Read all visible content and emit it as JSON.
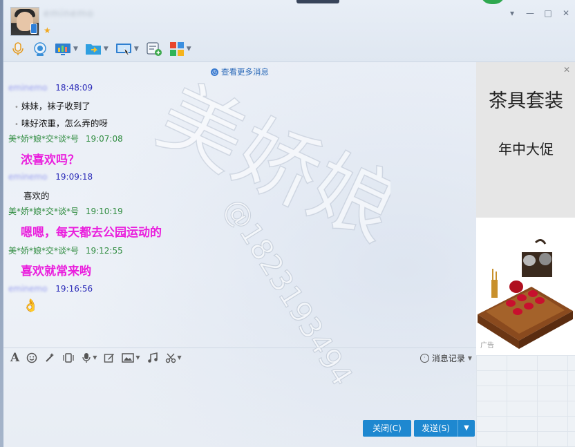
{
  "header": {
    "contact_name": "eminemo",
    "vip_star": "★",
    "window_controls": {
      "menu": "▾",
      "minimize": "—",
      "maximize": "□",
      "close": "✕"
    }
  },
  "toolbar": {
    "items": [
      {
        "icon": "microphone-icon",
        "color": "#f0a020"
      },
      {
        "icon": "webcam-icon",
        "color": "#3a8fd8"
      },
      {
        "icon": "screen-share-icon",
        "color": "#2f7fd0"
      },
      {
        "icon": "send-file-icon",
        "color": "#2f9fe0"
      },
      {
        "icon": "remote-assist-icon",
        "color": "#2f7fd0"
      },
      {
        "icon": "new-discussion-icon",
        "color": "#3ba84a"
      },
      {
        "icon": "apps-icon",
        "color": "#e8452c"
      }
    ]
  },
  "messages": {
    "more_link": "查看更多消息",
    "list": [
      {
        "sender": "eminemo",
        "time": "18:48:09",
        "lines": [
          "妹妹，袜子收到了",
          "味好浓重，怎么弄的呀"
        ]
      },
      {
        "sender": "美*娇*娘*交*谈*号",
        "time": "19:07:08",
        "big": "浓喜欢吗？"
      },
      {
        "sender": "eminemo",
        "time": "19:09:18",
        "lines": [
          "喜欢的"
        ]
      },
      {
        "sender": "美*娇*娘*交*谈*号",
        "time": "19:10:19",
        "big": "嗯嗯，每天都去公园运动的"
      },
      {
        "sender": "美*娇*娘*交*谈*号",
        "time": "19:12:55",
        "big": "喜欢就常来哟"
      },
      {
        "sender": "eminemo",
        "time": "19:16:56",
        "emoji": "👌"
      }
    ]
  },
  "watermark": {
    "text": "美娇娘",
    "number": "@1823193494"
  },
  "ad": {
    "close": "✕",
    "title": "茶具套装",
    "subtitle": "年中大促",
    "tag": "广告"
  },
  "input_toolbar": {
    "font_icon": "A",
    "history_label": "消息记录"
  },
  "input": {
    "value": ""
  },
  "buttons": {
    "close_label": "关闭(C)",
    "send_label": "发送(S)",
    "send_menu": "▼"
  },
  "colors": {
    "accent": "#1e88d0",
    "my_time": "#2a2ab8",
    "other_name": "#2e8b3e",
    "highlight_text": "#ea1fdd"
  }
}
